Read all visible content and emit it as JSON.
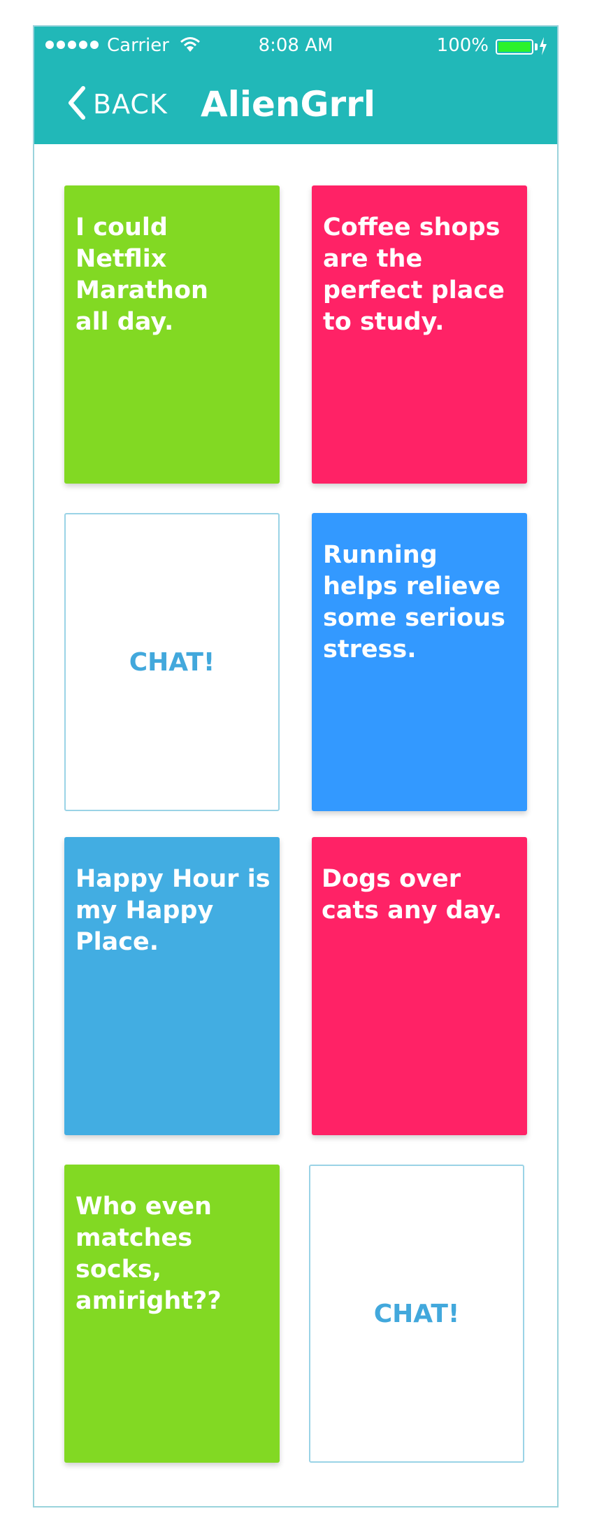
{
  "status_bar": {
    "carrier": "Carrier",
    "time": "8:08 AM",
    "battery": "100%"
  },
  "nav": {
    "back_label": "BACK",
    "title": "AlienGrrl"
  },
  "colors": {
    "header": "#21b8b8",
    "green": "#82d923",
    "pink": "#ff2266",
    "blue": "#3399ff",
    "light_blue": "#42ade2",
    "chat_text": "#42a8dc"
  },
  "cards": [
    {
      "type": "statement",
      "text": "I could Netflix Marathon all day.",
      "color": "#82d923"
    },
    {
      "type": "statement",
      "text": "Coffee shops are the perfect place to study.",
      "color": "#ff2266"
    },
    {
      "type": "chat",
      "text": "CHAT!"
    },
    {
      "type": "statement",
      "text": "Running helps relieve some serious stress.",
      "color": "#3399ff"
    },
    {
      "type": "statement",
      "text": "Happy Hour is my Happy Place.",
      "color": "#42ade2"
    },
    {
      "type": "statement",
      "text": "Dogs over cats any day.",
      "color": "#ff2266"
    },
    {
      "type": "statement",
      "text": "Who even matches socks, amiright??",
      "color": "#82d923"
    },
    {
      "type": "chat",
      "text": "CHAT!"
    }
  ]
}
